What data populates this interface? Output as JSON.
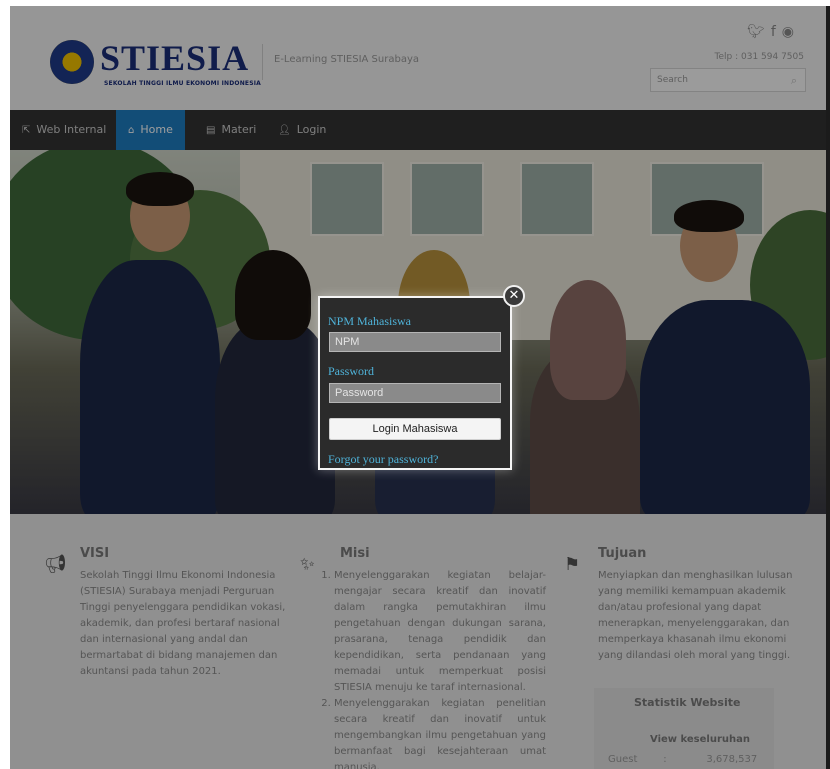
{
  "header": {
    "logo_text": "STIESIA",
    "logo_subtitle": "SEKOLAH TINGGI ILMU EKONOMI INDONESIA",
    "tagline": "E-Learning STIESIA Surabaya",
    "phone": "Telp : 031 594 7505",
    "search_placeholder": "Search",
    "social_icons": [
      "twitter-icon",
      "facebook-icon",
      "rss-icon"
    ]
  },
  "nav": {
    "items": [
      {
        "label": "Web Internal",
        "icon": "external-link-icon"
      },
      {
        "label": "Home",
        "icon": "home-icon",
        "active": true
      },
      {
        "label": "Materi",
        "icon": "document-icon"
      },
      {
        "label": "Login",
        "icon": "user-icon"
      }
    ]
  },
  "modal": {
    "npm_label": "NPM Mahasiswa",
    "npm_placeholder": "NPM",
    "password_label": "Password",
    "password_placeholder": "Password",
    "login_button": "Login Mahasiswa",
    "forgot_link": "Forgot your password?",
    "close_symbol": "✕"
  },
  "visi": {
    "title": "VISI",
    "text": "Sekolah Tinggi Ilmu Ekonomi Indonesia (STIESIA) Surabaya menjadi Perguruan Tinggi penyelenggara pendidikan vokasi, akademik, dan profesi bertaraf nasional dan internasional yang andal dan bermartabat di bidang manajemen dan akuntansi pada tahun 2021."
  },
  "misi": {
    "title": "Misi",
    "items": [
      "Menyelenggarakan kegiatan belajar-mengajar secara kreatif dan inovatif dalam rangka pemutakhiran ilmu pengetahuan dengan dukungan sarana, prasarana, tenaga pendidik dan kependidikan, serta pendanaan yang memadai untuk memperkuat posisi STIESIA menuju ke taraf internasional.",
      "Menyelenggarakan kegiatan penelitian secara kreatif dan inovatif untuk mengembangkan ilmu pengetahuan yang bermanfaat bagi kesejahteraan umat manusia."
    ]
  },
  "tujuan": {
    "title": "Tujuan",
    "text": "Menyiapkan dan menghasilkan lulusan yang memiliki kemampuan akademik dan/atau profesional yang dapat menerapkan, menyelenggarakan, dan memperkaya khasanah ilmu ekonomi yang dilandasi oleh moral yang tinggi."
  },
  "stats": {
    "title": "Statistik Website",
    "subtitle": "View keseluruhan",
    "rows": [
      {
        "label": "Guest",
        "sep": ":",
        "value": "3,678,537"
      }
    ]
  },
  "colors": {
    "nav_active": "#1e7cc0",
    "modal_label": "#4fb3d9",
    "logo_blue": "#1b2e7a"
  }
}
